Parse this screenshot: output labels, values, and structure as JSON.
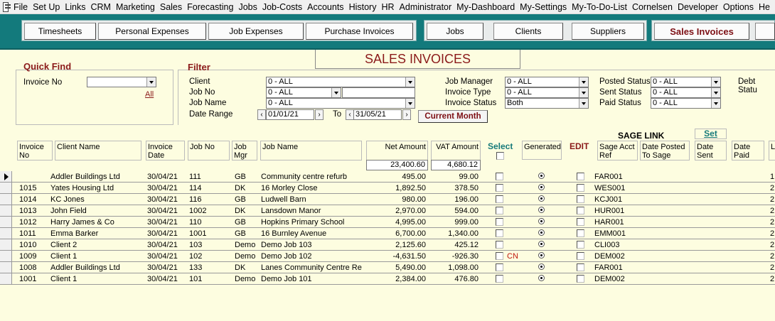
{
  "menu": [
    "File",
    "Set Up",
    "Links",
    "CRM",
    "Marketing",
    "Sales",
    "Forecasting",
    "Jobs",
    "Job-Costs",
    "Accounts",
    "History",
    "HR",
    "Administrator",
    "My-Dashboard",
    "My-Settings",
    "My-To-Do-List",
    "Cornelsen",
    "Developer",
    "Options",
    "He"
  ],
  "nav": {
    "timesheets": "Timesheets",
    "personal_expenses": "Personal Expenses",
    "job_expenses": "Job Expenses",
    "purchase_invoices": "Purchase Invoices",
    "jobs": "Jobs",
    "clients": "Clients",
    "suppliers": "Suppliers",
    "sales_invoices": "Sales Invoices"
  },
  "title": "SALES INVOICES",
  "quickfind": {
    "heading": "Quick Find",
    "invoice_label": "Invoice No",
    "invoice_value": "",
    "all_link": "All"
  },
  "filter": {
    "heading": "Filter",
    "client_label": "Client",
    "client_value": "0 - ALL",
    "jobno_label": "Job No",
    "jobno_value": "0 - ALL",
    "jobname_label": "Job Name",
    "jobname_value": "0 - ALL",
    "daterange_label": "Date Range",
    "date_from": "01/01/21",
    "to_label": "To",
    "date_to": "31/05/21",
    "current_month": "Current Month",
    "jobmgr_label": "Job Manager",
    "jobmgr_value": "0 - ALL",
    "invtype_label": "Invoice Type",
    "invtype_value": "0 - ALL",
    "invstatus_label": "Invoice Status",
    "invstatus_value": "Both",
    "posted_label": "Posted Status",
    "posted_value": "0 - ALL",
    "sent_label": "Sent Status",
    "sent_value": "0 - ALL",
    "paid_label": "Paid Status",
    "paid_value": "0 - ALL",
    "debt_label": "Debt Statu"
  },
  "columns": {
    "invoice_no": "Invoice No",
    "client_name": "Client Name",
    "invoice_date": "Invoice Date",
    "job_no": "Job No",
    "job_mgr": "Job Mgr",
    "job_name": "Job Name",
    "net_amount": "Net Amount",
    "vat_amount": "VAT Amount",
    "select": "Select",
    "generated": "Generated",
    "edit": "EDIT",
    "sage_link": "SAGE LINK",
    "sage_acct_ref": "Sage Acct Ref",
    "date_posted": "Date Posted To Sage",
    "set": "Set",
    "date_sent": "Date Sent",
    "date_paid": "Date Paid",
    "l": "L"
  },
  "totals": {
    "net": "23,400.60",
    "vat": "4,680.12"
  },
  "rows": [
    {
      "inv": "",
      "client": "Addler Buildings Ltd",
      "date": "30/04/21",
      "jobno": "111",
      "mgr": "GB",
      "jobname": "Community centre refurb",
      "net": "495.00",
      "vat": "99.00",
      "cn": "",
      "sage": "FAR001",
      "last": "1"
    },
    {
      "inv": "1015",
      "client": "Yates Housing Ltd",
      "date": "30/04/21",
      "jobno": "114",
      "mgr": "DK",
      "jobname": "16 Morley Close",
      "net": "1,892.50",
      "vat": "378.50",
      "cn": "",
      "sage": "WES001",
      "last": "2"
    },
    {
      "inv": "1014",
      "client": "KC Jones",
      "date": "30/04/21",
      "jobno": "116",
      "mgr": "GB",
      "jobname": "Ludwell Barn",
      "net": "980.00",
      "vat": "196.00",
      "cn": "",
      "sage": "KCJ001",
      "last": "2"
    },
    {
      "inv": "1013",
      "client": "John Field",
      "date": "30/04/21",
      "jobno": "1002",
      "mgr": "DK",
      "jobname": "Lansdown Manor",
      "net": "2,970.00",
      "vat": "594.00",
      "cn": "",
      "sage": "HUR001",
      "last": "2"
    },
    {
      "inv": "1012",
      "client": "Harry James & Co",
      "date": "30/04/21",
      "jobno": "110",
      "mgr": "GB",
      "jobname": "Hopkins Primary School",
      "net": "4,995.00",
      "vat": "999.00",
      "cn": "",
      "sage": "HAR001",
      "last": "2"
    },
    {
      "inv": "1011",
      "client": "Emma Barker",
      "date": "30/04/21",
      "jobno": "1001",
      "mgr": "GB",
      "jobname": "16 Burnley Avenue",
      "net": "6,700.00",
      "vat": "1,340.00",
      "cn": "",
      "sage": "EMM001",
      "last": "2"
    },
    {
      "inv": "1010",
      "client": "Client 2",
      "date": "30/04/21",
      "jobno": "103",
      "mgr": "Demo",
      "jobname": "Demo Job 103",
      "net": "2,125.60",
      "vat": "425.12",
      "cn": "",
      "sage": "CLI003",
      "last": "2"
    },
    {
      "inv": "1009",
      "client": "Client 1",
      "date": "30/04/21",
      "jobno": "102",
      "mgr": "Demo",
      "jobname": "Demo Job 102",
      "net": "-4,631.50",
      "vat": "-926.30",
      "cn": "CN",
      "sage": "DEM002",
      "last": "2"
    },
    {
      "inv": "1008",
      "client": "Addler Buildings Ltd",
      "date": "30/04/21",
      "jobno": "133",
      "mgr": "DK",
      "jobname": "Lanes Community Centre Refu",
      "net": "5,490.00",
      "vat": "1,098.00",
      "cn": "",
      "sage": "FAR001",
      "last": "2"
    },
    {
      "inv": "1001",
      "client": "Client 1",
      "date": "30/04/21",
      "jobno": "101",
      "mgr": "Demo",
      "jobname": "Demo Job 101",
      "net": "2,384.00",
      "vat": "476.80",
      "cn": "",
      "sage": "DEM002",
      "last": "2"
    }
  ]
}
